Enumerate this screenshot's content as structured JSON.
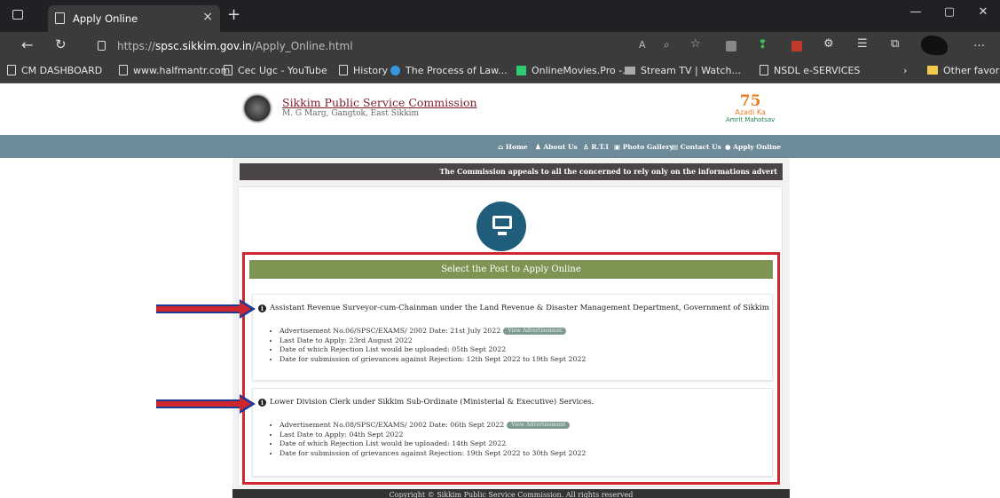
{
  "browser": {
    "tab_title": "Apply Online",
    "url_prefix": "https://",
    "url_host": "spsc.sikkim.gov.in",
    "url_path": "/Apply_Online.html",
    "bookmarks": [
      "CM DASHBOARD",
      "www.halfmantr.com",
      "Cec Ugc - YouTube",
      "History",
      "The Process of Law...",
      "OnlineMovies.Pro -...",
      "Stream TV | Watch...",
      "NSDL e-SERVICES"
    ],
    "other_favorites": "Other favorite"
  },
  "site": {
    "title": "Sikkim Public Service Commission",
    "subtitle": "M. G Marg, Gangtok, East Sikkim",
    "azadi_number": "75",
    "azadi_line1": "Azadi Ka",
    "azadi_line2": "Amrit Mahotsav"
  },
  "nav": [
    "Home",
    "About Us",
    "R.T.I",
    "Photo Gallery",
    "Contact Us",
    "Apply Online"
  ],
  "marquee": "The Commission appeals to all the concerned to rely only on the informations advert",
  "select_banner": "Select the Post to Apply Online",
  "view_label": "View Advertisement",
  "posts": [
    {
      "title": "Assistant Revenue Surveyor-cum-Chainman under the Land Revenue & Disaster Management Department, Government of Sikkim",
      "advertisement": "Advertisement No.06/SPSC/EXAMS/ 2002 Date: 21st July 2022",
      "last_date": "Last Date to Apply: 23rd August 2022",
      "rejection_list": "Date of which Rejection List would be uploaded: 05th Sept 2022",
      "grievances": "Date for submission of grievances against Rejection: 12th Sept 2022 to 19th Sept 2022"
    },
    {
      "title": "Lower Division Clerk under Sikkim Sub-Ordinate (Ministerial & Executive) Services.",
      "advertisement": "Advertisement No.08/SPSC/EXAMS/ 2002 Date: 06th Sept 2022",
      "last_date": "Last Date to Apply: 04th Sept 2022",
      "rejection_list": "Date of which Rejection List would be uploaded: 14th Sept 2022",
      "grievances": "Date for submission of grievances against Rejection: 19th Sept 2022 to 30th Sept 2022"
    }
  ],
  "footer": "Copyright © Sikkim Public Service Commission. All rights reserved",
  "colors": {
    "accent_red": "#d0262e",
    "banner_green": "#7e9453",
    "nav_blue": "#6d8a99",
    "monitor_blue": "#1f5d7a"
  }
}
